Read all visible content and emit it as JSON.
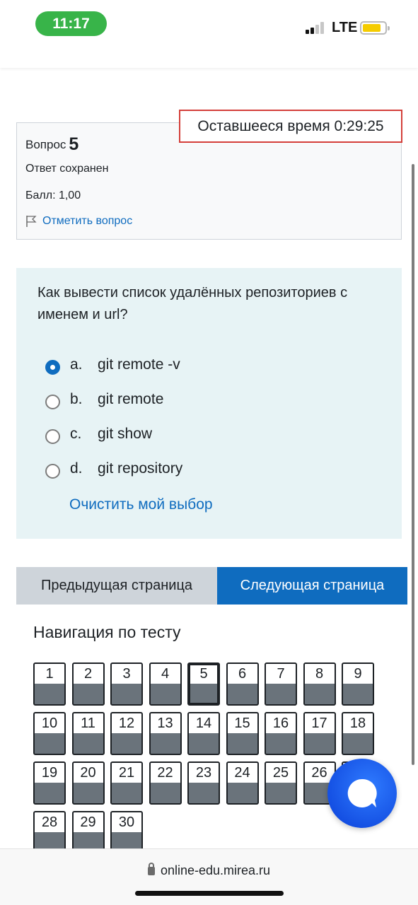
{
  "status_bar": {
    "time": "11:17",
    "network": "LTE",
    "time_pill_color": "#38b449",
    "battery_color": "#f5cc00"
  },
  "timer": {
    "label": "Оставшееся время 0:29:25"
  },
  "question_info": {
    "label": "Вопрос",
    "number": "5",
    "state": "Ответ сохранен",
    "grade": "Балл: 1,00",
    "flag_label": "Отметить вопрос"
  },
  "question": {
    "text": "Как вывести список удалённых репозиториев с именем и url?",
    "options": [
      {
        "letter": "a.",
        "text": "git remote -v",
        "selected": true
      },
      {
        "letter": "b.",
        "text": "git remote",
        "selected": false
      },
      {
        "letter": "c.",
        "text": "git show",
        "selected": false
      },
      {
        "letter": "d.",
        "text": "git repository",
        "selected": false
      }
    ],
    "clear_label": "Очистить мой выбор"
  },
  "pagination": {
    "prev_label": "Предыдущая страница",
    "next_label": "Следующая страница"
  },
  "navigation": {
    "title": "Навигация по тесту",
    "current": 5,
    "questions": [
      "1",
      "2",
      "3",
      "4",
      "5",
      "6",
      "7",
      "8",
      "9",
      "10",
      "11",
      "12",
      "13",
      "14",
      "15",
      "16",
      "17",
      "18",
      "19",
      "20",
      "21",
      "22",
      "23",
      "24",
      "25",
      "26",
      "27",
      "28",
      "29",
      "30"
    ]
  },
  "browser": {
    "url": "online-edu.mirea.ru"
  },
  "colors": {
    "accent": "#0f6cbf",
    "timer_border": "#d43f3a",
    "question_bg": "#e7f3f5",
    "answered": "#6a737b"
  }
}
